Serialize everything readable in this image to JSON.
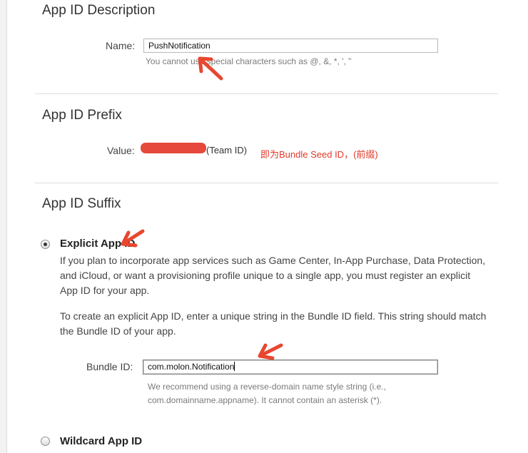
{
  "description_section": {
    "title": "App ID Description",
    "name_label": "Name:",
    "name_value": "PushNotification",
    "name_hint": "You cannot use special characters such as @, &, *, ', \""
  },
  "prefix_section": {
    "title": "App ID Prefix",
    "value_label": "Value:",
    "value_suffix": "(Team ID)",
    "annotation": "即为Bundle Seed ID，(前缀)"
  },
  "suffix_section": {
    "title": "App ID Suffix",
    "explicit": {
      "label": "Explicit App ID",
      "selected": true,
      "paragraph1": "If you plan to incorporate app services such as Game Center, In-App Purchase, Data Protection, and iCloud, or want a provisioning profile unique to a single app, you must register an explicit App ID for your app.",
      "paragraph2": "To create an explicit App ID, enter a unique string in the Bundle ID field. This string should match the Bundle ID of your app.",
      "bundle_label": "Bundle ID:",
      "bundle_value": "com.molon.Notification",
      "bundle_hint_line1": "We recommend using a reverse-domain name style string (i.e.,",
      "bundle_hint_line2": "com.domainname.appname). It cannot contain an asterisk (*)."
    },
    "wildcard": {
      "label": "Wildcard App ID",
      "selected": false
    }
  },
  "colors": {
    "annotation_red": "#e23a2a",
    "redaction_red": "#e6483c"
  }
}
